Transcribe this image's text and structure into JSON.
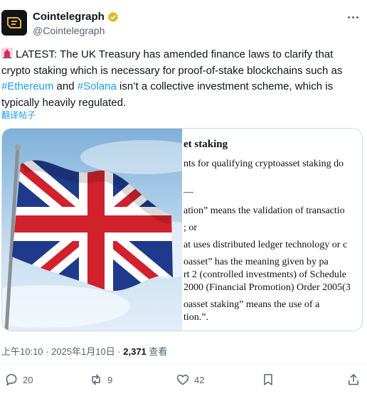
{
  "author": {
    "display_name": "Cointelegraph",
    "handle": "@Cointelegraph",
    "avatar_icon": "cointelegraph-logo-icon",
    "verified_icon": "gold-verified-badge-icon",
    "verified_color": "#e2b719"
  },
  "tweet": {
    "part1": "LATEST: The UK Treasury has amended finance laws to clarify that crypto staking which is necessary for proof-of-stake blockchains such as ",
    "hashtag1": "#Ethereum",
    "part2": " and ",
    "hashtag2": "#Solana",
    "part3": " isn’t a collective investment scheme, which is typically heavily regulated.",
    "siren_icon": "rotating-light-icon",
    "translate_label": "翻译帖子"
  },
  "media": {
    "left_image": "uk-flag-photo",
    "document_lines": [
      "et staking",
      "nts for qualifying cryptoasset staking do",
      "—",
      "ation” means the validation of transactio",
      "; or",
      "at uses distributed ledger technology or c",
      "oasset” has the meaning given by pa",
      "rt 2 (controlled investments) of Schedule",
      "2000 (Financial Promotion) Order 2005(3",
      "oasset staking” means the use of a",
      "tion.”."
    ]
  },
  "meta": {
    "time": "上午10:10 · 2025年1月10日 · ",
    "views_count": "2,371",
    "views_label": " 查看"
  },
  "actions": {
    "reply_count": "20",
    "repost_count": "9",
    "like_count": "42"
  },
  "colors": {
    "accent": "#1d9bf0",
    "text_secondary": "#536471",
    "border": "#cfd9de"
  }
}
